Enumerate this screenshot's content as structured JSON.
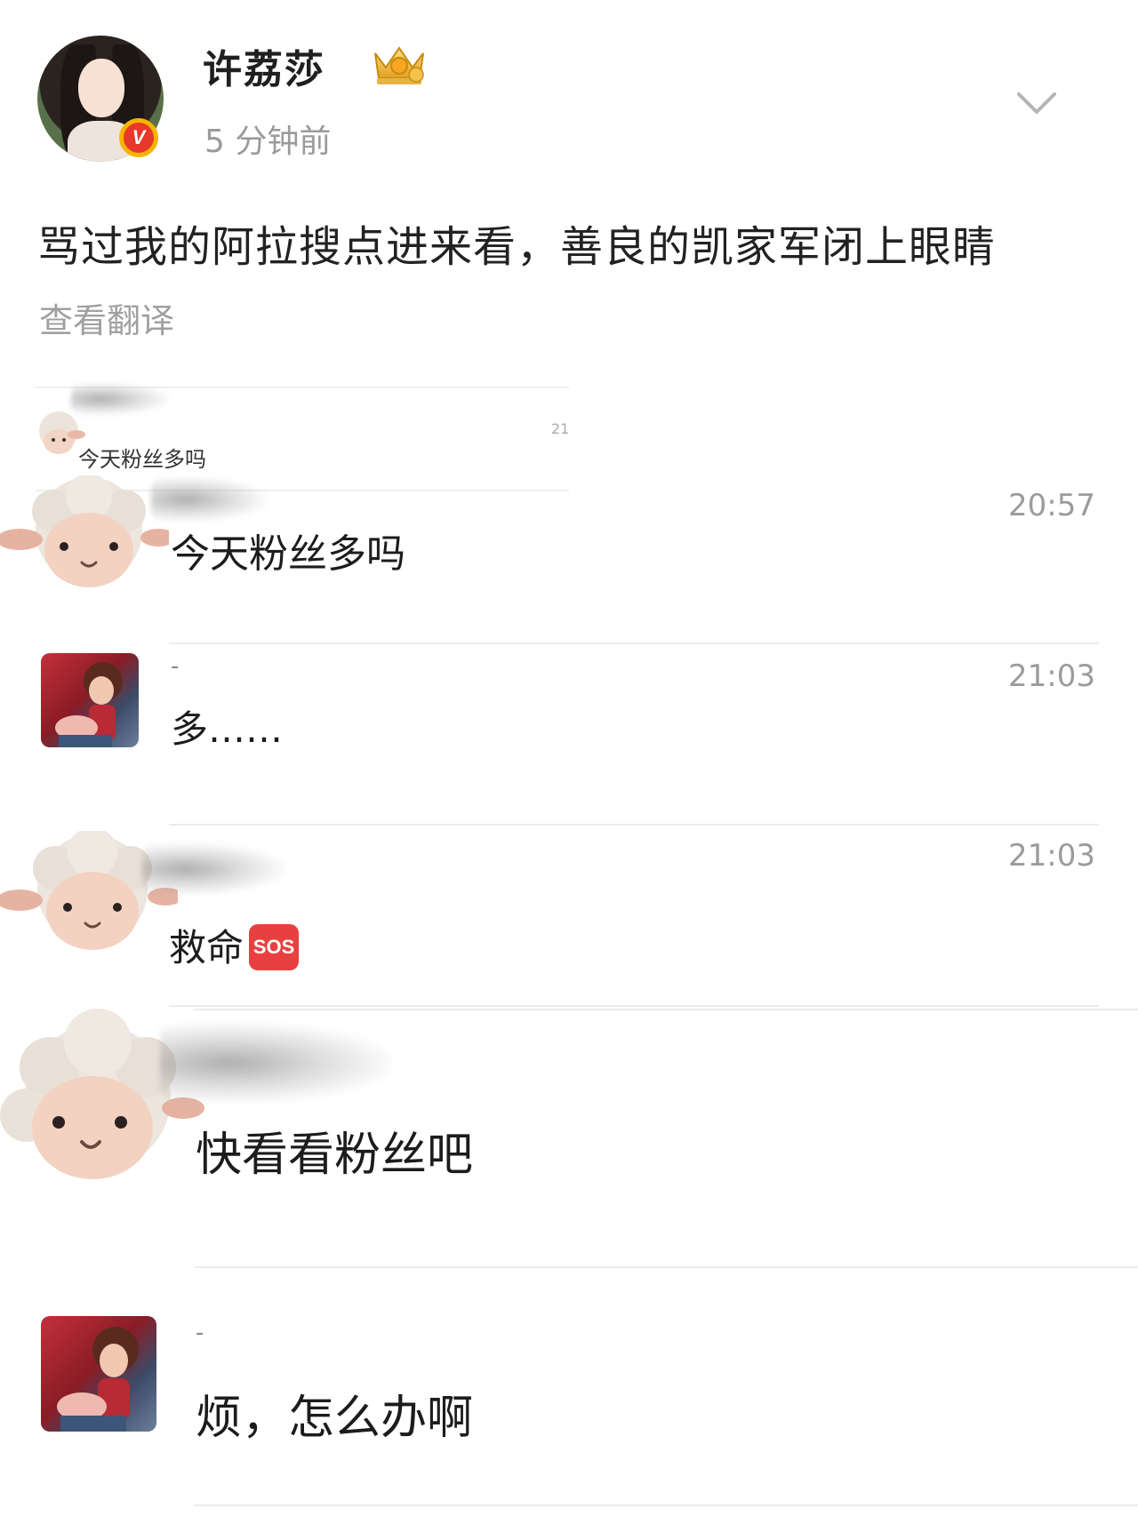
{
  "post": {
    "author_name": "许荔莎",
    "verified_mark": "V",
    "time_ago": "5 分钟前",
    "text": "骂过我的阿拉搜点进来看，善良的凯家军闭上眼睛",
    "translate_label": "查看翻译"
  },
  "chat": {
    "mini_preview": {
      "text": "今天粉丝多吗",
      "time": "21"
    },
    "messages": [
      {
        "username": "",
        "text": "今天粉丝多吗",
        "time": "20:57"
      },
      {
        "username": "-",
        "text": "多……",
        "time": "21:03"
      },
      {
        "username": "",
        "text": "救命",
        "badge": "SOS",
        "time": "21:03"
      },
      {
        "username": "",
        "text": "快看看粉丝吧",
        "time": ""
      },
      {
        "username": "-",
        "text": "烦，怎么办啊",
        "time": ""
      }
    ]
  },
  "colors": {
    "verified_red": "#e8382b",
    "verified_ring": "#f5b400",
    "sos_red": "#e84040",
    "muted_text": "#9b9b9b"
  },
  "icons": {
    "crown": "crown-icon",
    "chevron": "chevron-down-icon",
    "sheep_avatar": "sheep-avatar-icon"
  }
}
